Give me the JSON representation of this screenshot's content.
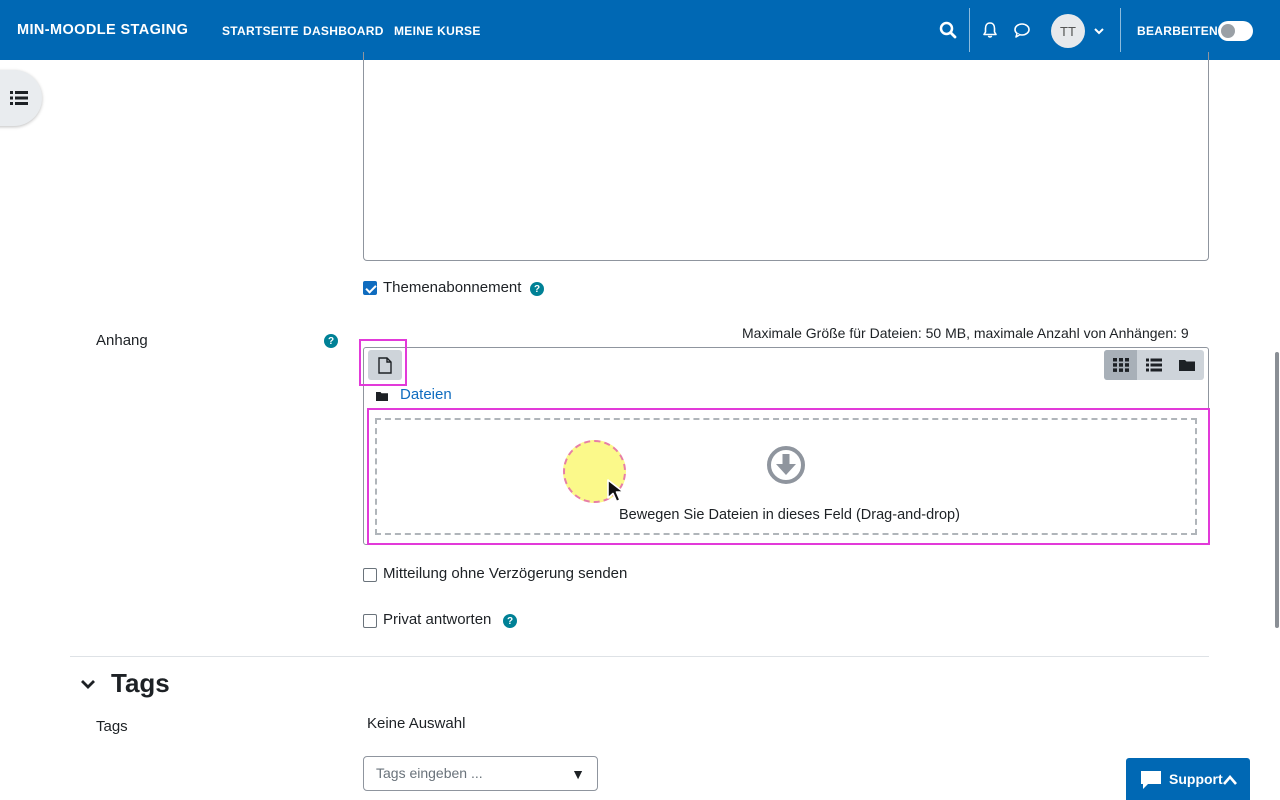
{
  "navbar": {
    "brand": "MIN-MOODLE STAGING",
    "links": [
      "STARTSEITE",
      "DASHBOARD",
      "MEINE KURSE"
    ],
    "avatar_initials": "TT",
    "edit_mode_label": "BEARBEITEN",
    "edit_mode_on": false
  },
  "form": {
    "subscription_label": "Themenabonnement",
    "subscription_checked": true,
    "attachment_label": "Anhang",
    "attachment_limits": "Maximale Größe für Dateien: 50 MB, maximale Anzahl von Anhängen: 9",
    "files_folder_label": "Dateien",
    "dropzone_text": "Bewegen Sie Dateien in dieses Feld (Drag-and-drop)",
    "no_delay_label": "Mitteilung ohne Verzögerung senden",
    "no_delay_checked": false,
    "private_reply_label": "Privat antworten",
    "private_reply_checked": false
  },
  "tags_section": {
    "title": "Tags",
    "field_label": "Tags",
    "selection_text": "Keine Auswahl",
    "input_placeholder": "Tags eingeben ..."
  },
  "support": {
    "label": "Support"
  },
  "colors": {
    "brand": "#0068b4",
    "link": "#0f6cbf",
    "help": "#008196",
    "highlight": "#e23ad9"
  }
}
